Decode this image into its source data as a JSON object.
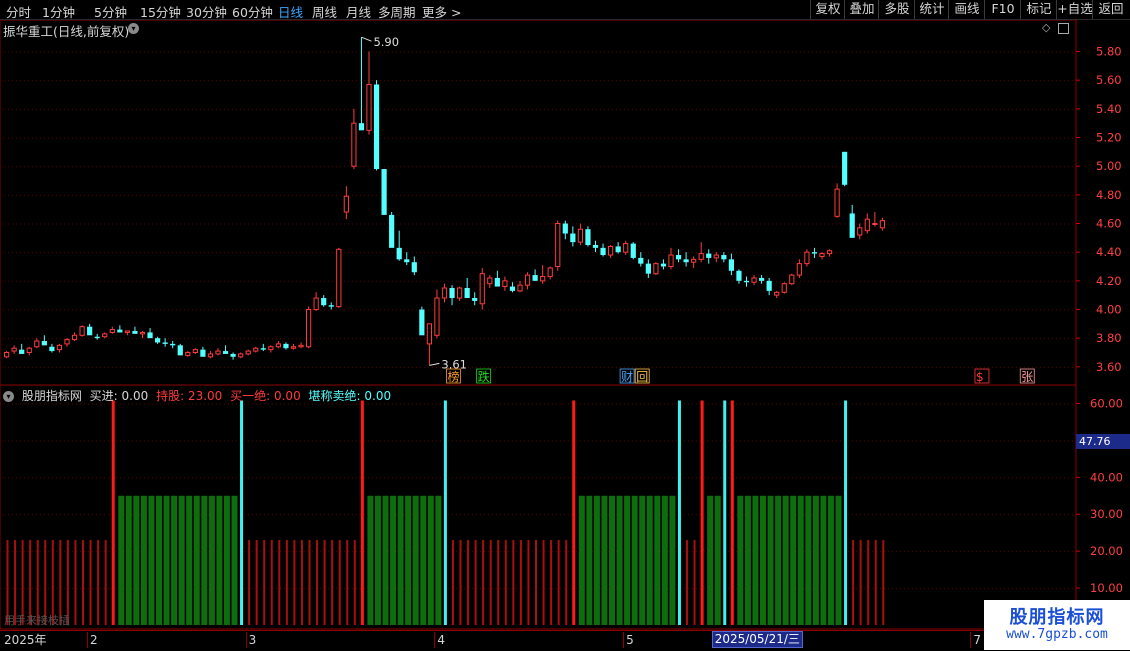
{
  "toolbar": {
    "periods": [
      "分时",
      "1分钟",
      "5分钟",
      "15分钟",
      "30分钟",
      "60分钟",
      "日线",
      "周线",
      "月线",
      "多周期",
      "更多 >"
    ],
    "active_period": "日线",
    "tools": [
      "复权",
      "叠加",
      "多股",
      "统计",
      "画线",
      "F10",
      "标记",
      "+自选",
      "返回"
    ]
  },
  "title": {
    "stock": "振华重工(日线,前复权)"
  },
  "colors": {
    "up": "#ff3b3b",
    "down": "#54ffff",
    "grid": "#8b0000",
    "hold": "#0e6e0e"
  },
  "chart_data": [
    {
      "type": "candlestick",
      "title": "振华重工(日线,前复权)",
      "ylim": [
        3.55,
        5.95
      ],
      "yticks": [
        "5.80",
        "5.60",
        "5.40",
        "5.20",
        "5.00",
        "4.80",
        "4.60",
        "4.40",
        "4.20",
        "4.00",
        "3.80",
        "3.60"
      ],
      "annotations": {
        "high": "5.90",
        "low": "3.61"
      },
      "markers": [
        {
          "text": "榜",
          "bar": 59,
          "color": "#ff9a2a"
        },
        {
          "text": "跌",
          "bar": 63,
          "color": "#22dd22"
        },
        {
          "text": "财",
          "bar": 82,
          "color": "#4aa8ff"
        },
        {
          "text": "回",
          "bar": 84,
          "color": "#ffc24a"
        },
        {
          "text": "$",
          "bar": 129,
          "color": "#ff3b3b"
        },
        {
          "text": "张",
          "bar": 135,
          "color": "#ff9a9a"
        }
      ],
      "ohlc": [
        [
          3.67,
          3.71,
          3.66,
          3.7
        ],
        [
          3.71,
          3.75,
          3.69,
          3.73
        ],
        [
          3.72,
          3.76,
          3.7,
          3.69
        ],
        [
          3.7,
          3.74,
          3.68,
          3.73
        ],
        [
          3.74,
          3.8,
          3.73,
          3.78
        ],
        [
          3.78,
          3.82,
          3.76,
          3.75
        ],
        [
          3.74,
          3.76,
          3.7,
          3.71
        ],
        [
          3.72,
          3.76,
          3.7,
          3.75
        ],
        [
          3.76,
          3.8,
          3.74,
          3.79
        ],
        [
          3.79,
          3.84,
          3.78,
          3.82
        ],
        [
          3.82,
          3.89,
          3.81,
          3.88
        ],
        [
          3.88,
          3.9,
          3.84,
          3.82
        ],
        [
          3.81,
          3.83,
          3.79,
          3.8
        ],
        [
          3.81,
          3.84,
          3.8,
          3.83
        ],
        [
          3.84,
          3.88,
          3.83,
          3.86
        ],
        [
          3.86,
          3.89,
          3.84,
          3.84
        ],
        [
          3.84,
          3.85,
          3.82,
          3.85
        ],
        [
          3.85,
          3.88,
          3.84,
          3.83
        ],
        [
          3.83,
          3.85,
          3.8,
          3.84
        ],
        [
          3.84,
          3.87,
          3.82,
          3.8
        ],
        [
          3.8,
          3.81,
          3.76,
          3.77
        ],
        [
          3.77,
          3.8,
          3.74,
          3.76
        ],
        [
          3.76,
          3.78,
          3.73,
          3.75
        ],
        [
          3.75,
          3.76,
          3.72,
          3.68
        ],
        [
          3.68,
          3.71,
          3.67,
          3.7
        ],
        [
          3.7,
          3.73,
          3.69,
          3.72
        ],
        [
          3.72,
          3.74,
          3.7,
          3.67
        ],
        [
          3.67,
          3.71,
          3.66,
          3.69
        ],
        [
          3.69,
          3.73,
          3.68,
          3.71
        ],
        [
          3.71,
          3.75,
          3.7,
          3.69
        ],
        [
          3.69,
          3.7,
          3.65,
          3.67
        ],
        [
          3.67,
          3.7,
          3.66,
          3.69
        ],
        [
          3.69,
          3.72,
          3.68,
          3.71
        ],
        [
          3.71,
          3.74,
          3.7,
          3.73
        ],
        [
          3.73,
          3.76,
          3.71,
          3.72
        ],
        [
          3.72,
          3.75,
          3.7,
          3.74
        ],
        [
          3.74,
          3.78,
          3.73,
          3.76
        ],
        [
          3.76,
          3.77,
          3.72,
          3.73
        ],
        [
          3.73,
          3.76,
          3.72,
          3.74
        ],
        [
          3.74,
          3.77,
          3.73,
          3.75
        ],
        [
          3.74,
          4.02,
          3.73,
          4.0
        ],
        [
          4.0,
          4.12,
          3.99,
          4.08
        ],
        [
          4.08,
          4.1,
          4.02,
          4.03
        ],
        [
          4.03,
          4.05,
          4.0,
          4.02
        ],
        [
          4.02,
          4.43,
          4.01,
          4.42
        ],
        [
          4.68,
          4.86,
          4.63,
          4.79
        ],
        [
          5.0,
          5.4,
          4.98,
          5.3
        ],
        [
          5.3,
          5.9,
          5.28,
          5.25
        ],
        [
          5.25,
          5.8,
          5.22,
          5.57
        ],
        [
          5.57,
          5.6,
          4.97,
          4.98
        ],
        [
          4.98,
          4.97,
          4.75,
          4.66
        ],
        [
          4.66,
          4.68,
          4.44,
          4.43
        ],
        [
          4.43,
          4.55,
          4.34,
          4.35
        ],
        [
          4.35,
          4.4,
          4.31,
          4.33
        ],
        [
          4.33,
          4.37,
          4.24,
          4.26
        ],
        [
          4.0,
          4.02,
          3.95,
          3.82
        ],
        [
          3.76,
          3.9,
          3.61,
          3.9
        ],
        [
          3.82,
          4.14,
          3.8,
          4.08
        ],
        [
          4.08,
          4.18,
          4.05,
          4.15
        ],
        [
          4.15,
          4.17,
          4.03,
          4.08
        ],
        [
          4.08,
          4.16,
          4.06,
          4.15
        ],
        [
          4.15,
          4.22,
          4.11,
          4.08
        ],
        [
          4.08,
          4.12,
          4.03,
          4.06
        ],
        [
          4.04,
          4.29,
          4.0,
          4.25
        ],
        [
          4.18,
          4.24,
          4.15,
          4.22
        ],
        [
          4.22,
          4.27,
          4.18,
          4.16
        ],
        [
          4.16,
          4.23,
          4.13,
          4.2
        ],
        [
          4.16,
          4.19,
          4.12,
          4.13
        ],
        [
          4.13,
          4.2,
          4.12,
          4.17
        ],
        [
          4.17,
          4.26,
          4.14,
          4.24
        ],
        [
          4.24,
          4.28,
          4.2,
          4.2
        ],
        [
          4.2,
          4.31,
          4.18,
          4.23
        ],
        [
          4.23,
          4.3,
          4.21,
          4.29
        ],
        [
          4.3,
          4.62,
          4.27,
          4.6
        ],
        [
          4.6,
          4.62,
          4.49,
          4.53
        ],
        [
          4.53,
          4.58,
          4.44,
          4.47
        ],
        [
          4.47,
          4.6,
          4.45,
          4.56
        ],
        [
          4.56,
          4.58,
          4.44,
          4.45
        ],
        [
          4.45,
          4.48,
          4.4,
          4.43
        ],
        [
          4.43,
          4.46,
          4.37,
          4.38
        ],
        [
          4.38,
          4.45,
          4.36,
          4.44
        ],
        [
          4.44,
          4.47,
          4.39,
          4.4
        ],
        [
          4.4,
          4.48,
          4.38,
          4.46
        ],
        [
          4.46,
          4.47,
          4.35,
          4.36
        ],
        [
          4.36,
          4.4,
          4.3,
          4.32
        ],
        [
          4.32,
          4.35,
          4.22,
          4.25
        ],
        [
          4.25,
          4.33,
          4.24,
          4.32
        ],
        [
          4.32,
          4.35,
          4.28,
          4.3
        ],
        [
          4.3,
          4.43,
          4.28,
          4.38
        ],
        [
          4.38,
          4.42,
          4.33,
          4.35
        ],
        [
          4.35,
          4.4,
          4.3,
          4.33
        ],
        [
          4.33,
          4.37,
          4.29,
          4.35
        ],
        [
          4.35,
          4.47,
          4.33,
          4.39
        ],
        [
          4.39,
          4.42,
          4.32,
          4.36
        ],
        [
          4.36,
          4.4,
          4.33,
          4.38
        ],
        [
          4.38,
          4.4,
          4.33,
          4.35
        ],
        [
          4.35,
          4.39,
          4.24,
          4.27
        ],
        [
          4.27,
          4.28,
          4.18,
          4.2
        ],
        [
          4.2,
          4.23,
          4.16,
          4.19
        ],
        [
          4.19,
          4.24,
          4.17,
          4.22
        ],
        [
          4.22,
          4.24,
          4.18,
          4.2
        ],
        [
          4.2,
          4.22,
          4.1,
          4.13
        ],
        [
          4.1,
          4.13,
          4.08,
          4.12
        ],
        [
          4.12,
          4.19,
          4.11,
          4.18
        ],
        [
          4.18,
          4.25,
          4.17,
          4.24
        ],
        [
          4.24,
          4.35,
          4.22,
          4.32
        ],
        [
          4.32,
          4.42,
          4.3,
          4.4
        ],
        [
          4.4,
          4.43,
          4.36,
          4.39
        ],
        [
          4.37,
          4.4,
          4.35,
          4.39
        ],
        [
          4.39,
          4.42,
          4.37,
          4.41
        ],
        [
          4.65,
          4.88,
          4.64,
          4.84
        ],
        [
          5.1,
          5.1,
          4.86,
          4.87
        ],
        [
          4.67,
          4.73,
          4.5,
          4.5
        ],
        [
          4.52,
          4.6,
          4.49,
          4.57
        ],
        [
          4.55,
          4.67,
          4.53,
          4.63
        ],
        [
          4.6,
          4.68,
          4.58,
          4.6
        ],
        [
          4.57,
          4.64,
          4.55,
          4.62
        ]
      ]
    },
    {
      "type": "bar",
      "title": "股朋指标网",
      "legend": [
        {
          "label": "买进: 0.00",
          "color": "#d6d6d6"
        },
        {
          "label": "持股: 23.00",
          "color": "#ff3b3b"
        },
        {
          "label": "买一绝: 0.00",
          "color": "#ff3b3b"
        },
        {
          "label": "堪称卖绝: 0.00",
          "color": "#54ffff"
        }
      ],
      "ylim": [
        0,
        65
      ],
      "yticks": [
        "60.00",
        "50.00",
        "40.00",
        "30.00",
        "20.00",
        "10.00"
      ],
      "cursor_value": "47.76",
      "base_value": 23,
      "hold_value": 35,
      "buy_signal_bars": [
        14,
        47,
        75,
        92,
        96
      ],
      "sell_signal_bars": [
        31,
        58,
        89,
        95,
        111,
        121
      ],
      "hold_ranges": [
        [
          15,
          31
        ],
        [
          48,
          58
        ],
        [
          76,
          89
        ],
        [
          93,
          95
        ],
        [
          97,
          111
        ]
      ]
    }
  ],
  "date_axis": {
    "labels": [
      "2025年",
      "2",
      "3",
      "4",
      "5",
      "6",
      "7"
    ],
    "cursor_date": "2025/05/21/三"
  },
  "indicator_footer": "用手来接枝插",
  "watermark": {
    "title": "股朋指标网",
    "url": "www.7gpzb.com"
  }
}
